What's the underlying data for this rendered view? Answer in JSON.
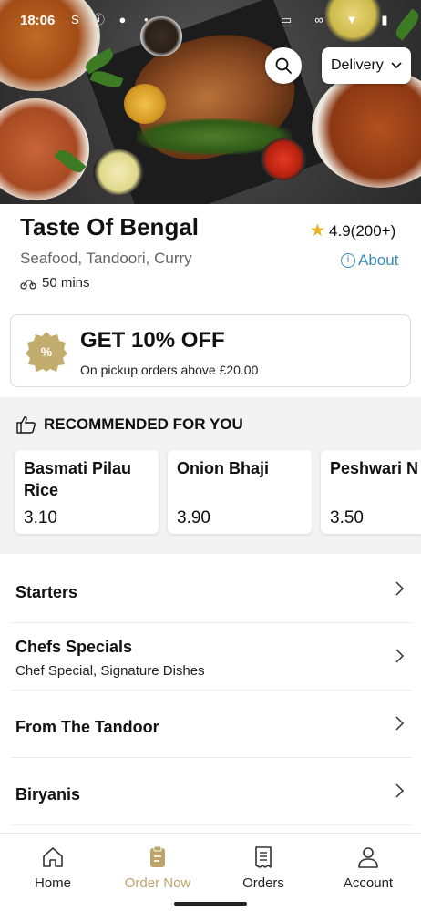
{
  "status_bar": {
    "time": "18:06"
  },
  "header": {
    "delivery_mode": "Delivery",
    "icons": [
      "search-icon",
      "chevron-down-icon"
    ]
  },
  "restaurant": {
    "name": "Taste Of Bengal",
    "rating": "4.9(200+)",
    "cuisines": "Seafood, Tandoori, Curry",
    "about_label": "About",
    "eta": "50 mins"
  },
  "offer": {
    "title": "GET 10% OFF",
    "subtitle": "On pickup orders above £20.00",
    "badge_color": "#c2ad6e"
  },
  "recommended": {
    "heading": "RECOMMENDED FOR YOU",
    "items": [
      {
        "name": "Basmati Pilau Rice",
        "price": "3.10"
      },
      {
        "name": "Onion Bhaji",
        "price": "3.90"
      },
      {
        "name": "Peshwari N",
        "price": "3.50"
      }
    ]
  },
  "categories": [
    {
      "name": "Starters",
      "description": ""
    },
    {
      "name": "Chefs Specials",
      "description": "Chef Special, Signature Dishes"
    },
    {
      "name": "From The Tandoor",
      "description": ""
    },
    {
      "name": "Biryanis",
      "description": ""
    }
  ],
  "bottom_nav": {
    "items": [
      {
        "label": "Home",
        "icon": "home-icon"
      },
      {
        "label": "Order Now",
        "icon": "order-icon",
        "active": true
      },
      {
        "label": "Orders",
        "icon": "receipt-icon"
      },
      {
        "label": "Account",
        "icon": "person-icon"
      }
    ],
    "active_color": "#bca46c"
  },
  "colors": {
    "accent": "#bca46c",
    "link": "#3a8bb8",
    "star": "#e7b421"
  }
}
